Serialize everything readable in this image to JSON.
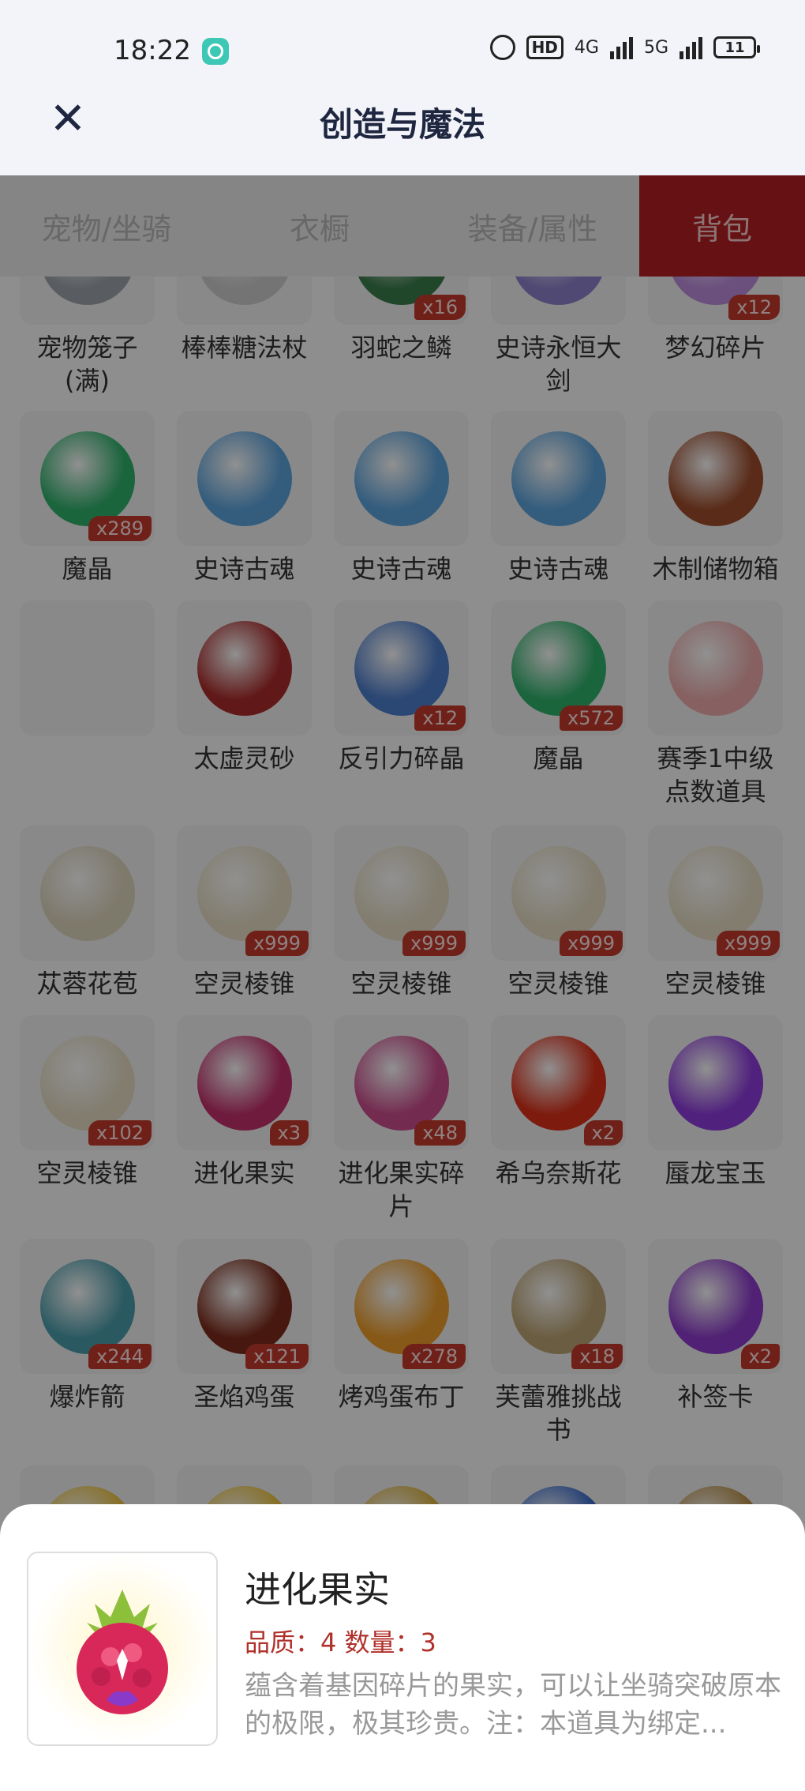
{
  "status": {
    "time": "18:22",
    "hd": "HD",
    "net1": "4G",
    "net2": "5G",
    "battery": "11"
  },
  "header": {
    "close": "✕",
    "title": "创造与魔法"
  },
  "tabs": [
    "宠物/坐骑",
    "衣橱",
    "装备/属性",
    "背包"
  ],
  "grid": [
    [
      {
        "name": "宠物笼子(满)",
        "badge": "",
        "color": "#9aa0a8"
      },
      {
        "name": "棒棒糖法杖",
        "badge": "",
        "color": "#c8c8c8"
      },
      {
        "name": "羽蛇之鳞",
        "badge": "x16",
        "color": "#3a7a4a"
      },
      {
        "name": "史诗永恒大剑",
        "badge": "",
        "color": "#8a7ec8"
      },
      {
        "name": "梦幻碎片",
        "badge": "x12",
        "color": "#b88ad8"
      }
    ],
    [
      {
        "name": "魔晶",
        "badge": "x289",
        "color": "#2fae6a"
      },
      {
        "name": "史诗古魂",
        "badge": "",
        "color": "#5aa0d8"
      },
      {
        "name": "史诗古魂",
        "badge": "",
        "color": "#5aa0d8"
      },
      {
        "name": "史诗古魂",
        "badge": "",
        "color": "#5aa0d8"
      },
      {
        "name": "木制储物箱",
        "badge": "",
        "color": "#9a4a2a"
      }
    ],
    [
      {
        "name": "",
        "badge": "",
        "color": ""
      },
      {
        "name": "太虚灵砂",
        "badge": "",
        "color": "#a82a2a"
      },
      {
        "name": "反引力碎晶",
        "badge": "x12",
        "color": "#4a7ac8"
      },
      {
        "name": "魔晶",
        "badge": "x572",
        "color": "#2fae6a"
      },
      {
        "name": "赛季1中级点数道具",
        "badge": "",
        "color": "#e8a8a8"
      }
    ],
    [
      {
        "name": "苁蓉花苞",
        "badge": "",
        "color": "#d8d0b8"
      },
      {
        "name": "空灵棱锥",
        "badge": "x999",
        "color": "#e0d8c0"
      },
      {
        "name": "空灵棱锥",
        "badge": "x999",
        "color": "#e0d8c0"
      },
      {
        "name": "空灵棱锥",
        "badge": "x999",
        "color": "#e0d8c0"
      },
      {
        "name": "空灵棱锥",
        "badge": "x999",
        "color": "#e0d8c0"
      }
    ],
    [
      {
        "name": "空灵棱锥",
        "badge": "x102",
        "color": "#e0d8c0"
      },
      {
        "name": "进化果实",
        "badge": "x3",
        "color": "#c0306a"
      },
      {
        "name": "进化果实碎片",
        "badge": "x48",
        "color": "#c84a8a"
      },
      {
        "name": "希乌奈斯花",
        "badge": "x2",
        "color": "#d8301a"
      },
      {
        "name": "蜃龙宝玉",
        "badge": "",
        "color": "#8a3ad8"
      }
    ],
    [
      {
        "name": "爆炸箭",
        "badge": "x244",
        "color": "#4a9aa8"
      },
      {
        "name": "圣焰鸡蛋",
        "badge": "x121",
        "color": "#7a2a1a"
      },
      {
        "name": "烤鸡蛋布丁",
        "badge": "x278",
        "color": "#e89a2a"
      },
      {
        "name": "芙蕾雅挑战书",
        "badge": "x18",
        "color": "#b8a070"
      },
      {
        "name": "补签卡",
        "badge": "x2",
        "color": "#8a3ac8"
      }
    ],
    [
      {
        "name": "",
        "badge": "",
        "color": "#e8c040"
      },
      {
        "name": "",
        "badge": "",
        "color": "#e8c040"
      },
      {
        "name": "",
        "badge": "",
        "color": "#d8b040"
      },
      {
        "name": "",
        "badge": "",
        "color": "#3a6ac8"
      },
      {
        "name": "",
        "badge": "",
        "color": "#b8904a"
      }
    ]
  ],
  "sheet": {
    "title": "进化果实",
    "meta": "品质：4   数量：3",
    "desc": "蕴含着基因碎片的果实，可以让坐骑突破原本的极限，极其珍贵。注：本道具为绑定..."
  }
}
